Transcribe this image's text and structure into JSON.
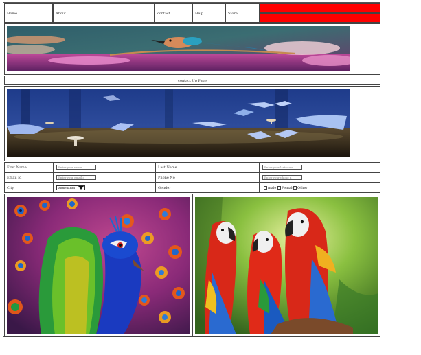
{
  "nav": {
    "items": [
      "Home",
      "About",
      "contact",
      "Help",
      "Store"
    ],
    "accent_color": "#ff0000"
  },
  "banner1": {
    "image": "bird-on-branch-pink-sunset"
  },
  "section": {
    "title": "contact Up Page"
  },
  "banner2": {
    "image": "night-forest-mushrooms-moths"
  },
  "form": {
    "first_name_label": "First Name",
    "first_name_placeholder": "Enter your name",
    "last_name_label": "Last Name",
    "last_name_placeholder": "Enter your lastname",
    "email_label": "Email Id",
    "email_placeholder": "Enter your emailid",
    "phone_label": "Phone No",
    "phone_placeholder": "Enter your phone n",
    "city_label": "City",
    "city_value": "Ahmedabad",
    "gender_label": "Gender",
    "gender_options": [
      "male",
      "Female",
      "Other"
    ]
  },
  "gallery": {
    "left": "peacock-colorful",
    "right": "macaw-parrots"
  }
}
